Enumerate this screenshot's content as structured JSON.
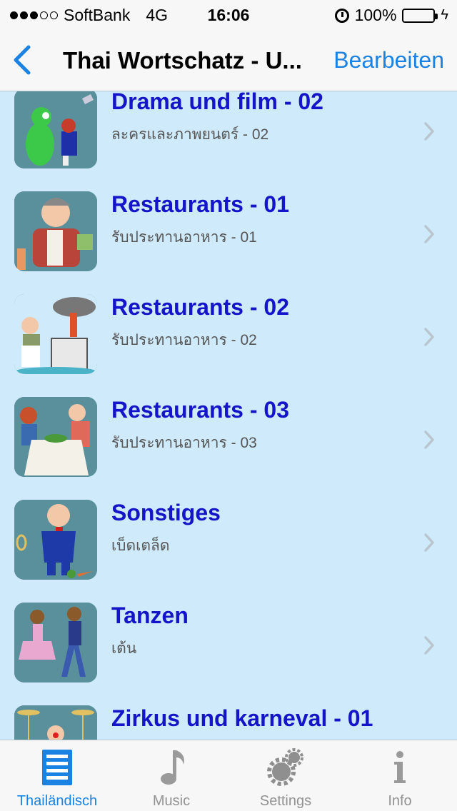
{
  "status": {
    "carrier": "SoftBank",
    "network": "4G",
    "time": "16:06",
    "battery": "100%"
  },
  "nav": {
    "back_icon": "chevron-left-icon",
    "title": "Thai Wortschatz - U...",
    "edit_label": "Bearbeiten"
  },
  "colors": {
    "accent": "#1a82e2",
    "title_blue": "#1414c8",
    "list_bg": "#cfeafa"
  },
  "list": {
    "items": [
      {
        "title": "Drama und film - 02",
        "subtitle": "ละครและภาพยนตร์ - 02",
        "icon": "drama-alien-icon"
      },
      {
        "title": "Restaurants - 01",
        "subtitle": "รับประทานอาหาร - 01",
        "icon": "waiter-icon"
      },
      {
        "title": "Restaurants - 02",
        "subtitle": "รับประทานอาหาร - 02",
        "icon": "cook-stove-icon"
      },
      {
        "title": "Restaurants - 03",
        "subtitle": "รับประทานอาหาร - 03",
        "icon": "dinner-couple-icon"
      },
      {
        "title": "Sonstiges",
        "subtitle": "เบ็ดเตล็ด",
        "icon": "butler-icon"
      },
      {
        "title": "Tanzen",
        "subtitle": "เต้น",
        "icon": "dancing-couple-icon"
      },
      {
        "title": "Zirkus und karneval - 01",
        "subtitle": "",
        "icon": "circus-clown-icon"
      }
    ]
  },
  "tabs": [
    {
      "label": "Thailändisch",
      "icon": "list-icon",
      "active": true
    },
    {
      "label": "Music",
      "icon": "music-note-icon",
      "active": false
    },
    {
      "label": "Settings",
      "icon": "gears-icon",
      "active": false
    },
    {
      "label": "Info",
      "icon": "info-icon",
      "active": false
    }
  ]
}
